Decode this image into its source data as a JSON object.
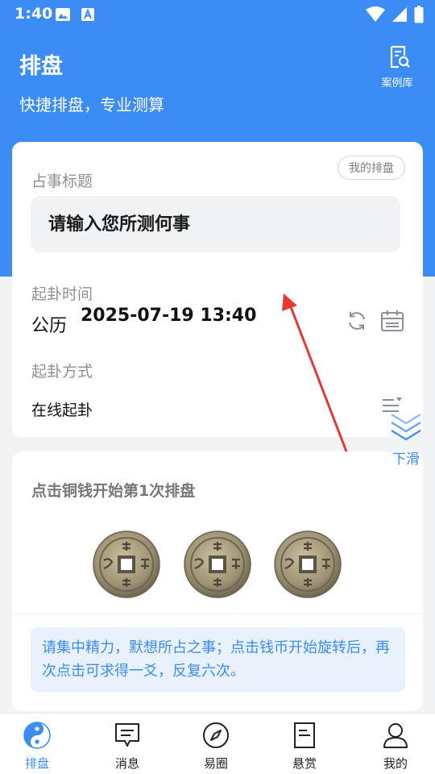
{
  "status_bar": {
    "time": "1:40"
  },
  "header": {
    "title": "排盘",
    "subtitle": "快捷排盘，专业测算",
    "cases_label": "案例库"
  },
  "form": {
    "my_chart_label": "我的排盘",
    "subject_label": "占事标题",
    "subject_placeholder": "请输入您所测何事",
    "time_label": "起卦时间",
    "calendar_type": "公历",
    "datetime": "2025-07-19 13:40",
    "method_label": "起卦方式",
    "method_value": "在线起卦"
  },
  "coins_panel": {
    "title": "点击铜钱开始第1次排盘",
    "coins": [
      "coin",
      "coin",
      "coin"
    ],
    "tip": "请集中精力，默想所占之事；点击钱币开始旋转后，再次点击可求得一爻，反复六次。"
  },
  "slide_hint": "下滑",
  "tabs": [
    {
      "label": "排盘",
      "icon": "yin-yang-icon",
      "active": true
    },
    {
      "label": "消息",
      "icon": "message-icon",
      "active": false
    },
    {
      "label": "易圈",
      "icon": "compass-icon",
      "active": false
    },
    {
      "label": "悬赏",
      "icon": "document-icon",
      "active": false
    },
    {
      "label": "我的",
      "icon": "user-icon",
      "active": false
    }
  ],
  "colors": {
    "brand": "#3b8cf5",
    "annotation_arrow": "#e53935"
  }
}
